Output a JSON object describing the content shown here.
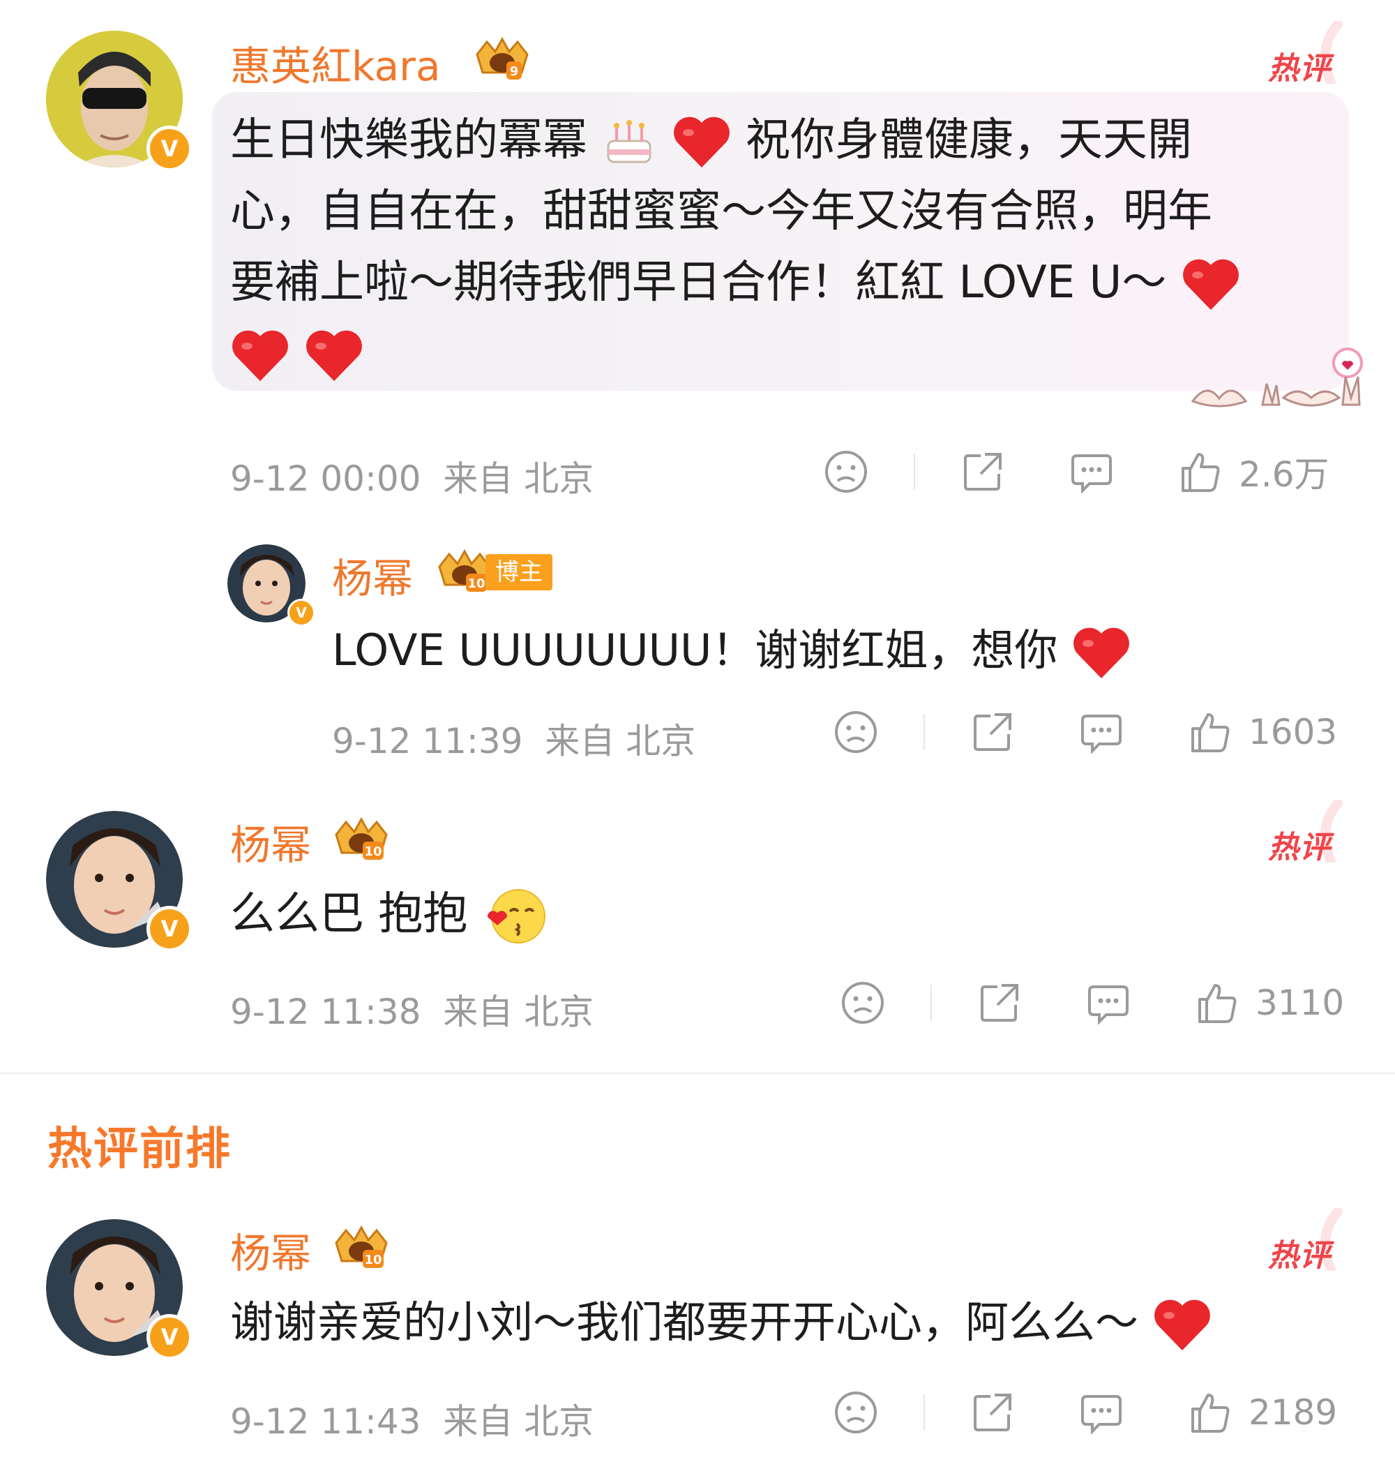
{
  "comments": [
    {
      "user": "惠英紅kara",
      "level": "9",
      "hot_label": "热评",
      "text_lines": [
        "生日快樂我的冪冪",
        "祝你身體健康，天天開",
        "心，自自在在，甜甜蜜蜜～今年又沒有合照，明年",
        "要補上啦～期待我們早日合作！紅紅 LOVE U～"
      ],
      "time": "9-12 00:00",
      "location": "来自 北京",
      "likes": "2.6万"
    },
    {
      "user": "杨幂",
      "level": "10",
      "tag": "博主",
      "text_lines": [
        "LOVE UUUUUUUU！谢谢红姐，想你"
      ],
      "time": "9-12 11:39",
      "location": "来自 北京",
      "likes": "1603"
    },
    {
      "user": "杨幂",
      "level": "10",
      "hot_label": "热评",
      "text_lines": [
        "么么巴 抱抱"
      ],
      "time": "9-12 11:38",
      "location": "来自 北京",
      "likes": "3110"
    },
    {
      "user": "杨幂",
      "level": "10",
      "hot_label": "热评",
      "text_lines": [
        "谢谢亲爱的小刘～我们都要开开心心，阿么么～"
      ],
      "time": "9-12 11:43",
      "location": "来自 北京",
      "likes": "2189"
    }
  ],
  "section_title": "热评前排",
  "icons": {
    "dislike": "sad-face-icon",
    "share": "share-icon",
    "reply": "comment-icon",
    "like": "thumbs-up-icon",
    "verified": "verified-v-icon",
    "crown": "crown-icon"
  },
  "colors": {
    "username": "#f0772c",
    "hot": "#f0454a",
    "meta": "#9a9a9a",
    "verified": "#f7a11a",
    "section": "#f7782a"
  },
  "verified_mark": "V"
}
